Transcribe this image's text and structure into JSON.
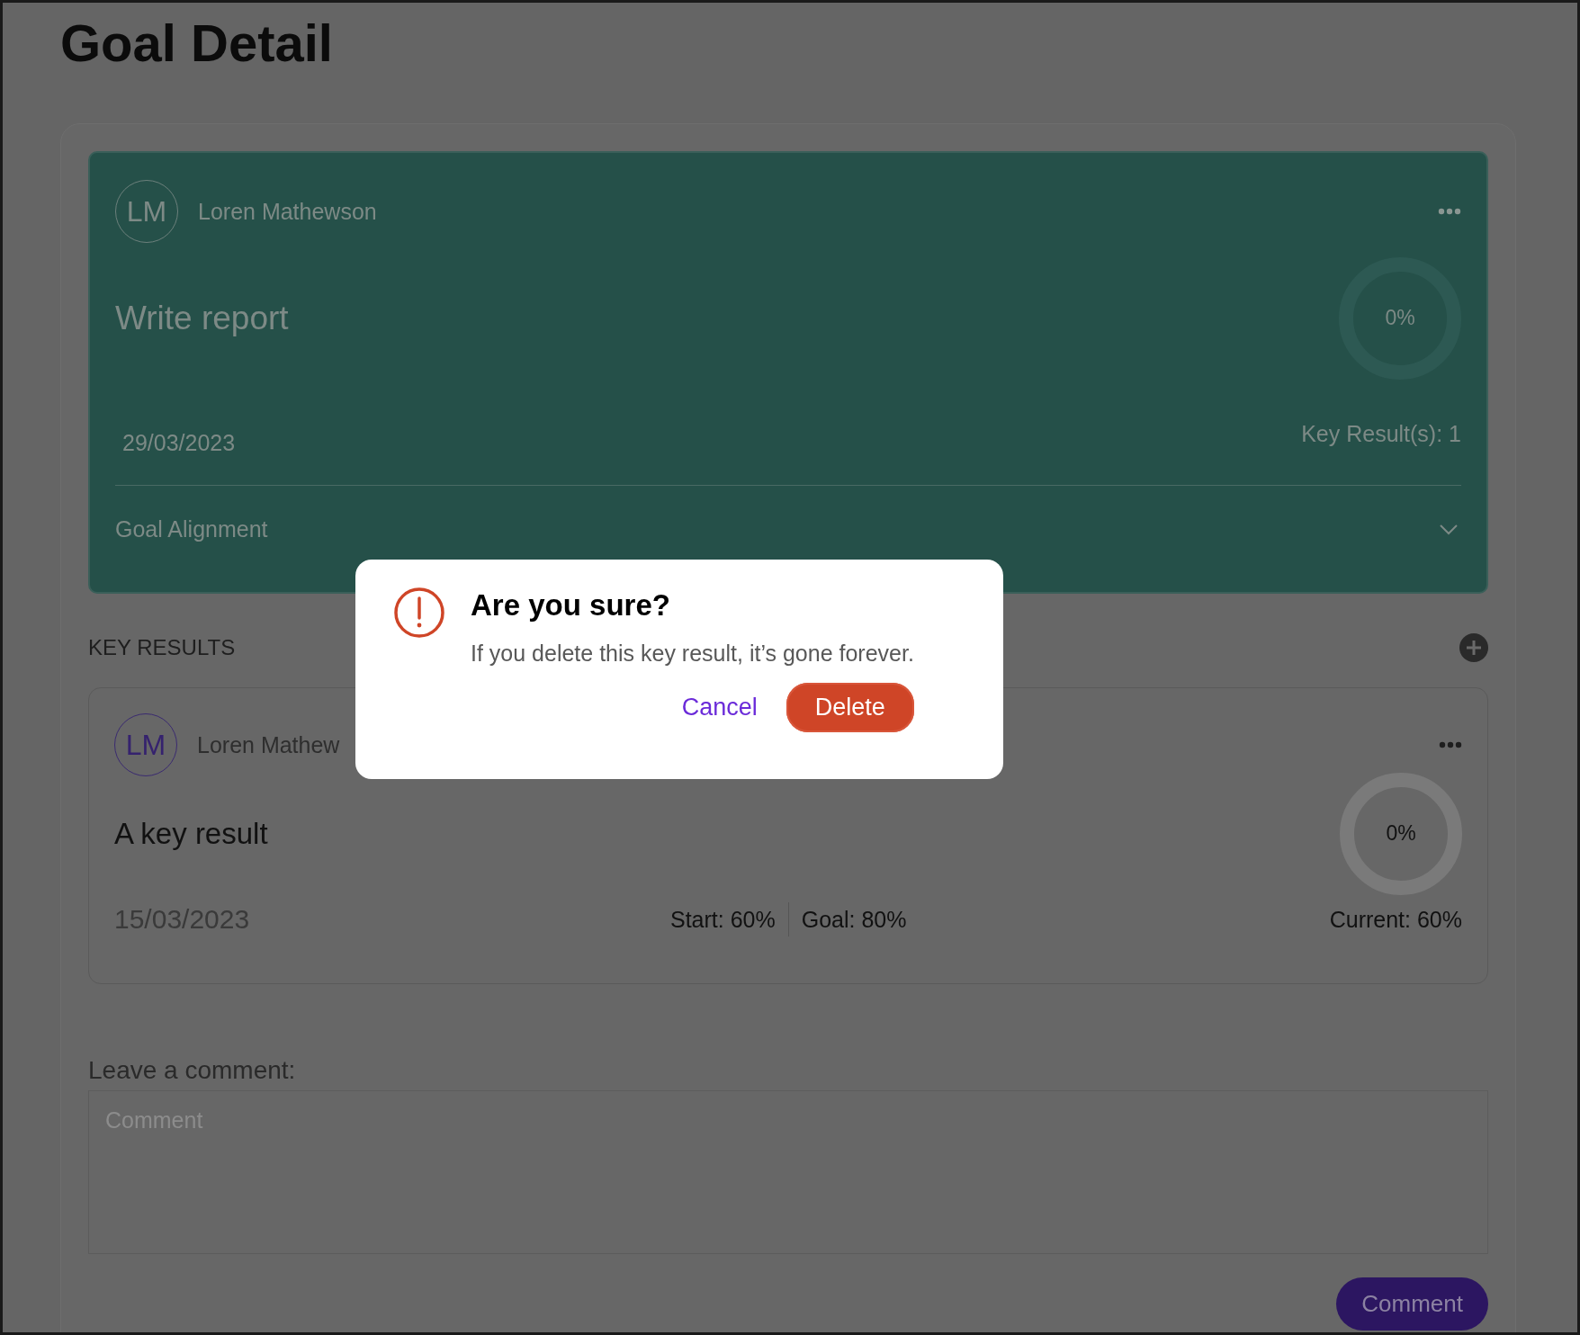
{
  "page": {
    "title": "Goal Detail"
  },
  "goal": {
    "avatar": "LM",
    "owner": "Loren Mathewson",
    "title": "Write report",
    "progress": {
      "level": 0,
      "label": "0%"
    },
    "date": "29/03/2023",
    "key_results_count": "Key Result(s): 1",
    "alignment": {
      "label": "Goal Alignment",
      "expanded": false
    }
  },
  "key_results": {
    "heading": "KEY RESULTS",
    "items": [
      {
        "avatar": "LM",
        "owner": "Loren Mathew",
        "title": "A key result",
        "progress": {
          "level": 0,
          "label": "0%"
        },
        "date": "15/03/2023",
        "start": "Start: 60%",
        "goal": "Goal: 80%",
        "current": "Current: 60%"
      }
    ]
  },
  "comment": {
    "label": "Leave a comment:",
    "placeholder": "Comment",
    "button": "Comment"
  },
  "dialog": {
    "title": "Are you sure?",
    "message": "If you delete this key result, it’s gone forever.",
    "buttons": [
      {
        "label": "Cancel",
        "kind": "link"
      },
      {
        "label": "Delete",
        "kind": "danger"
      }
    ]
  }
}
